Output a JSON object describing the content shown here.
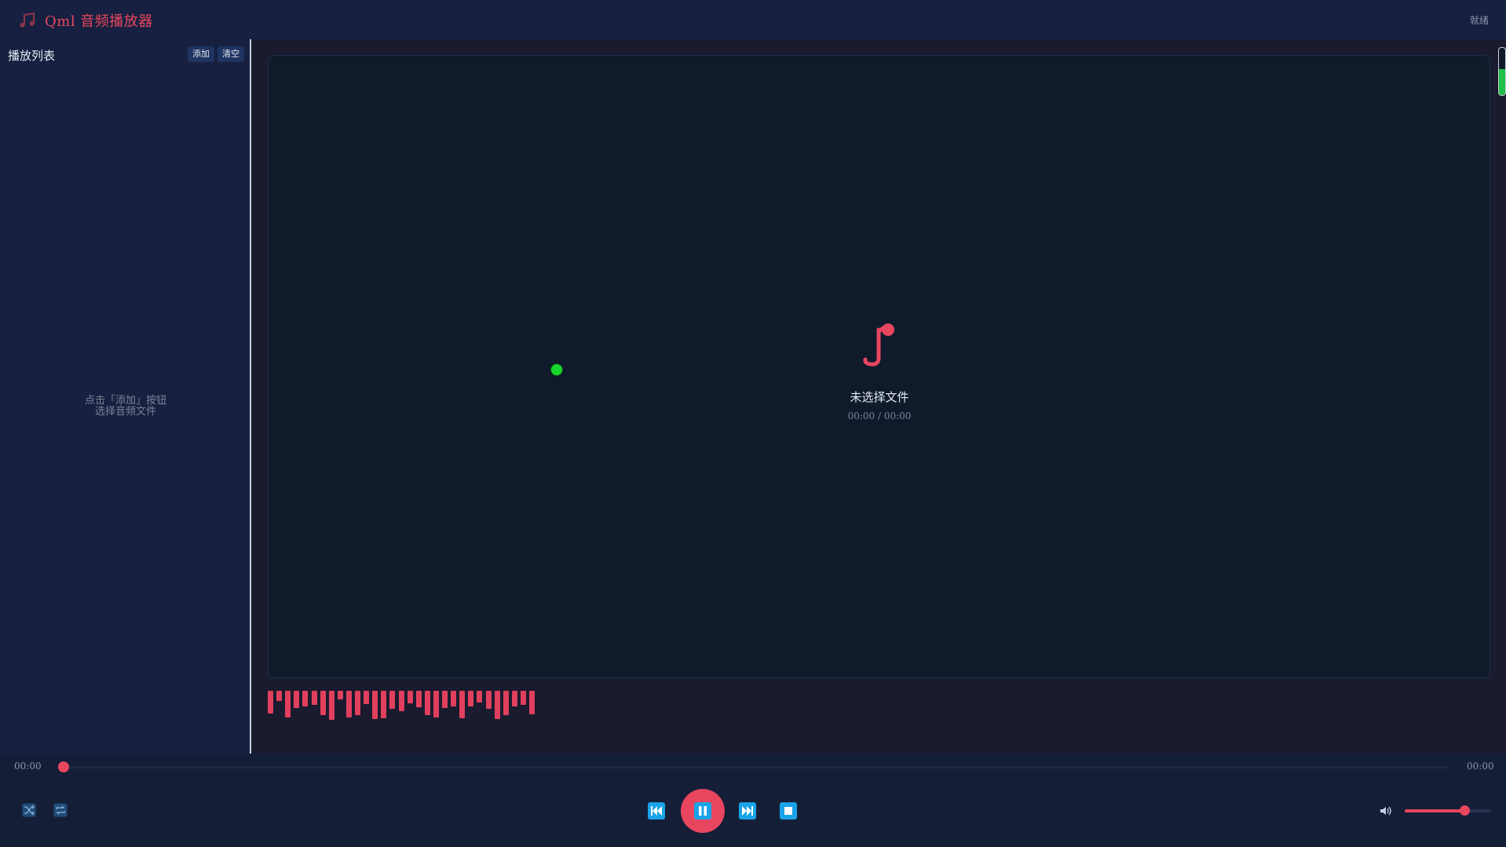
{
  "app": {
    "title": "Qml 音频播放器",
    "status": "就绪",
    "accent_color": "#e8465f",
    "logo_icon": "music-note-icon"
  },
  "sidebar": {
    "title": "播放列表",
    "add_label": "添加",
    "clear_label": "清空",
    "empty_hint_line1": "点击「添加」按钮",
    "empty_hint_line2": "选择音频文件"
  },
  "now_playing": {
    "title": "未选择文件",
    "time": "00:00 / 00:00",
    "icon": "music-note-icon"
  },
  "spectrum": {
    "bar_color": "#e0405d",
    "levels": [
      0.55,
      0.25,
      0.65,
      0.42,
      0.38,
      0.35,
      0.6,
      0.72,
      0.22,
      0.65,
      0.6,
      0.32,
      0.7,
      0.68,
      0.45,
      0.5,
      0.3,
      0.4,
      0.6,
      0.65,
      0.42,
      0.38,
      0.68,
      0.38,
      0.28,
      0.45,
      0.7,
      0.6,
      0.38,
      0.35,
      0.58
    ]
  },
  "level_meter": {
    "level": 0.55,
    "color": "#1fbf4a"
  },
  "progress": {
    "current": "00:00",
    "total": "00:00",
    "fraction": 0
  },
  "controls": {
    "shuffle_icon": "shuffle-icon",
    "repeat_icon": "repeat-icon",
    "prev_icon": "skip-previous-icon",
    "play_pause_icon": "pause-icon",
    "next_icon": "skip-next-icon",
    "stop_icon": "stop-icon",
    "transport_color": "#1aa3e8"
  },
  "volume": {
    "icon": "volume-icon",
    "level": 0.69
  }
}
